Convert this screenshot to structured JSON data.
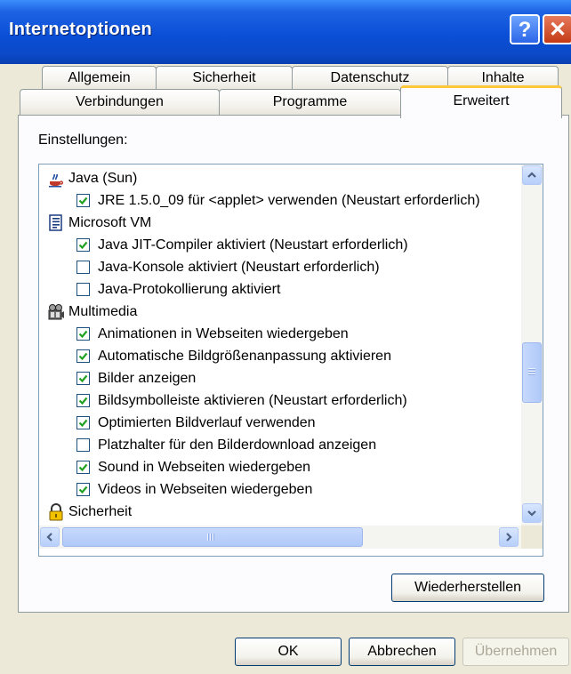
{
  "window": {
    "title": "Internetoptionen",
    "help_label": "?",
    "close_label": "✕"
  },
  "tabs": {
    "row1": [
      "Allgemein",
      "Sicherheit",
      "Datenschutz",
      "Inhalte"
    ],
    "row2": [
      "Verbindungen",
      "Programme",
      "Erweitert"
    ],
    "active": "Erweitert"
  },
  "settings": {
    "label": "Einstellungen:",
    "items": [
      {
        "type": "category",
        "label": "Java (Sun)",
        "icon": "java-icon"
      },
      {
        "type": "option",
        "label": "JRE 1.5.0_09 für <applet> verwenden (Neustart erforderlich)",
        "checked": true
      },
      {
        "type": "category",
        "label": "Microsoft VM",
        "icon": "document-icon"
      },
      {
        "type": "option",
        "label": "Java JIT-Compiler aktiviert (Neustart erforderlich)",
        "checked": true
      },
      {
        "type": "option",
        "label": "Java-Konsole aktiviert (Neustart erforderlich)",
        "checked": false
      },
      {
        "type": "option",
        "label": "Java-Protokollierung aktiviert",
        "checked": false
      },
      {
        "type": "category",
        "label": "Multimedia",
        "icon": "multimedia-icon"
      },
      {
        "type": "option",
        "label": "Animationen in Webseiten wiedergeben",
        "checked": true
      },
      {
        "type": "option",
        "label": "Automatische Bildgrößenanpassung aktivieren",
        "checked": true
      },
      {
        "type": "option",
        "label": "Bilder anzeigen",
        "checked": true
      },
      {
        "type": "option",
        "label": "Bildsymbolleiste aktivieren (Neustart erforderlich)",
        "checked": true
      },
      {
        "type": "option",
        "label": "Optimierten Bildverlauf verwenden",
        "checked": true
      },
      {
        "type": "option",
        "label": "Platzhalter für den Bilderdownload anzeigen",
        "checked": false
      },
      {
        "type": "option",
        "label": "Sound in Webseiten wiedergeben",
        "checked": true
      },
      {
        "type": "option",
        "label": "Videos in Webseiten wiedergeben",
        "checked": true
      },
      {
        "type": "category",
        "label": "Sicherheit",
        "icon": "lock-icon"
      }
    ]
  },
  "buttons": {
    "restore": "Wiederherstellen",
    "ok": "OK",
    "cancel": "Abbrechen",
    "apply": "Übernehmen"
  },
  "colors": {
    "titlebar": "#0a4fd6",
    "active_tab_accent": "#ffc83c",
    "checkmark": "#21a121"
  }
}
